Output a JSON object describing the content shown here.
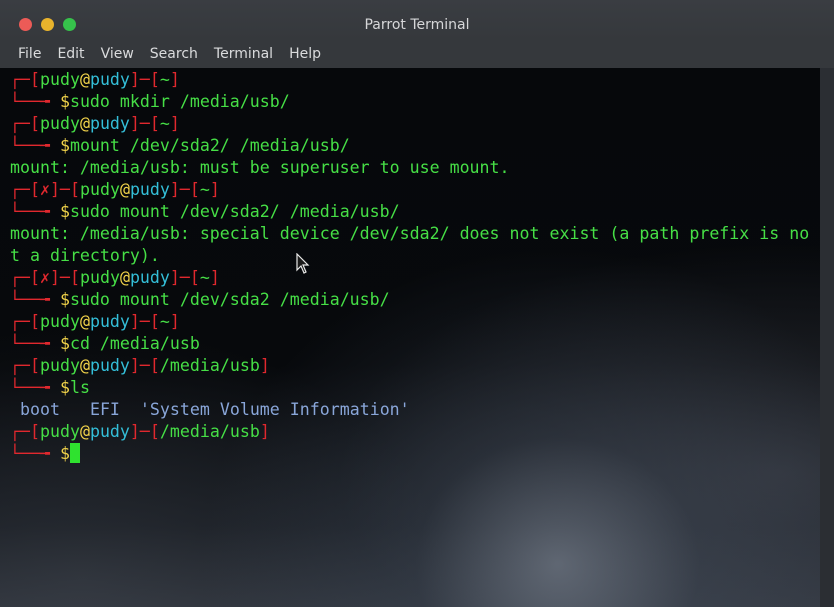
{
  "window": {
    "title": "Parrot Terminal",
    "menu": [
      "File",
      "Edit",
      "View",
      "Search",
      "Terminal",
      "Help"
    ]
  },
  "prompt": {
    "user": "pudy",
    "at": "@",
    "host": "pudy",
    "corner_top": "┌─[",
    "corner_bottom": "└──╼ ",
    "dollar": "$",
    "err_mark": "✗"
  },
  "lines": [
    {
      "kind": "prompt",
      "dir": "~",
      "err": false
    },
    {
      "kind": "cmd",
      "text": "sudo mkdir /media/usb/"
    },
    {
      "kind": "prompt",
      "dir": "~",
      "err": false
    },
    {
      "kind": "cmd",
      "text": "mount /dev/sda2/ /media/usb/"
    },
    {
      "kind": "out",
      "text": "mount: /media/usb: must be superuser to use mount."
    },
    {
      "kind": "prompt",
      "dir": "~",
      "err": true
    },
    {
      "kind": "cmd",
      "text": "sudo mount /dev/sda2/ /media/usb/"
    },
    {
      "kind": "out",
      "text": "mount: /media/usb: special device /dev/sda2/ does not exist (a path prefix is no"
    },
    {
      "kind": "out",
      "text": "t a directory)."
    },
    {
      "kind": "prompt",
      "dir": "~",
      "err": true
    },
    {
      "kind": "cmd",
      "text": "sudo mount /dev/sda2 /media/usb/"
    },
    {
      "kind": "prompt",
      "dir": "~",
      "err": false
    },
    {
      "kind": "cmd",
      "text": "cd /media/usb"
    },
    {
      "kind": "prompt",
      "dir": "/media/usb",
      "err": false
    },
    {
      "kind": "cmd",
      "text": "ls"
    },
    {
      "kind": "ls",
      "items": [
        "boot",
        "EFI",
        "'System Volume Information'"
      ]
    },
    {
      "kind": "prompt",
      "dir": "/media/usb",
      "err": false
    },
    {
      "kind": "input",
      "text": ""
    }
  ],
  "colors": {
    "prompt_bracket": "#e0282e",
    "user": "#46df46",
    "host": "#34bfd9",
    "at": "#f0d24a",
    "command": "#46df46",
    "ls_output": "#89a6d9"
  }
}
